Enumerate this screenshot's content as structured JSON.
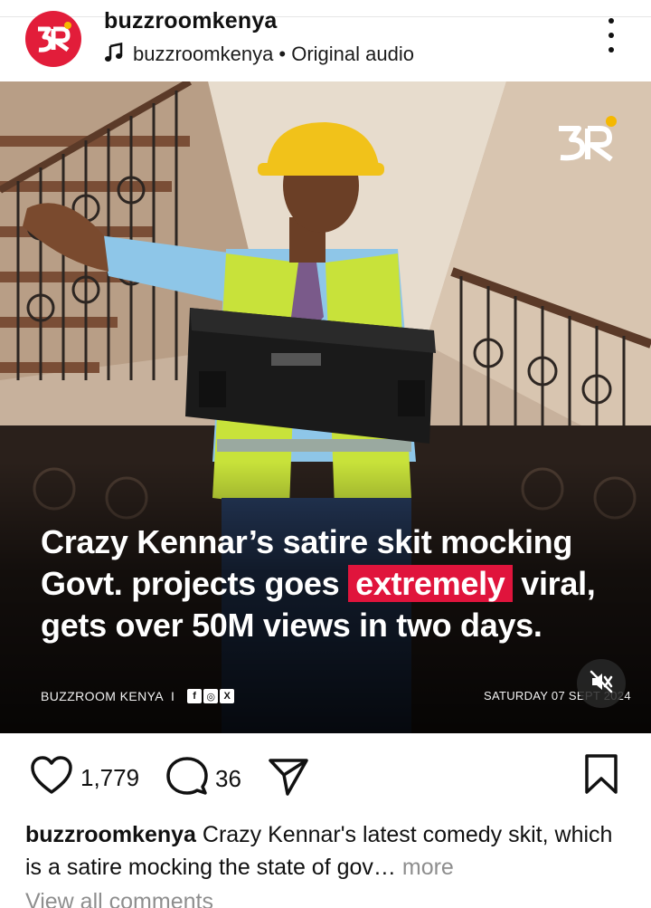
{
  "post": {
    "username": "buzzroomkenya",
    "audio_label": "buzzroomkenya • Original audio",
    "avatar_initials": "3R",
    "brand_color": "#e21d3a"
  },
  "media": {
    "logo_text": "3R",
    "headline_part1": "Crazy Kennar’s satire skit mocking Govt. projects goes ",
    "headline_highlight": "extremely",
    "headline_part2": " viral, gets over 50M views in two days.",
    "highlight_color": "#e0143c",
    "brand_footer": "BUZZROOM KENYA",
    "brand_separator": "I",
    "social_icons": [
      "facebook-icon",
      "instagram-icon",
      "x-icon"
    ],
    "social_glyphs": [
      "f",
      "◎",
      "X"
    ],
    "date_text": "SATURDAY 07 SEPT 2024",
    "muted": true
  },
  "actions": {
    "like_count": "1,779",
    "comment_count": "36"
  },
  "caption": {
    "username": "buzzroomkenya",
    "text": " Crazy Kennar's latest comedy skit, which is a satire mocking the state of gov…",
    "more_label": " more",
    "view_comments": "View all comments"
  }
}
